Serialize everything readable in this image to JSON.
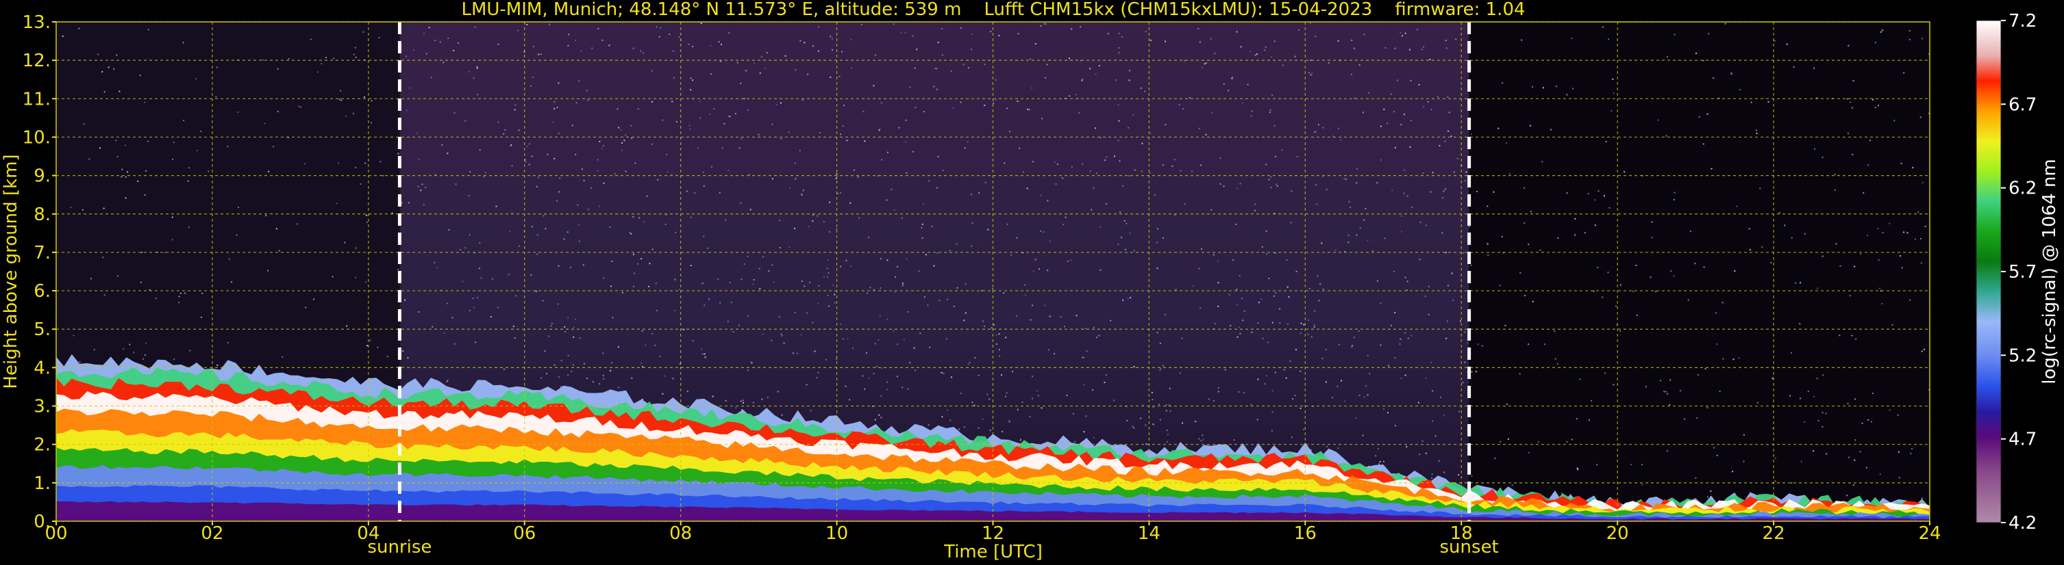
{
  "chart_data": {
    "type": "heatmap",
    "title": "LMU-MIM, Munich; 48.148° N 11.573° E, altitude: 539 m    Lufft CHM15kx (CHM15kxLMU): 15-04-2023    firmware: 1.04",
    "xlabel": "Time [UTC]",
    "ylabel": "Height above ground [km]",
    "xlim": [
      0,
      24
    ],
    "ylim": [
      0,
      13
    ],
    "x_ticks": [
      "00",
      "02",
      "04",
      "06",
      "08",
      "10",
      "12",
      "14",
      "16",
      "18",
      "20",
      "22",
      "24"
    ],
    "y_ticks": [
      "0.",
      "1.",
      "2.",
      "3.",
      "4.",
      "5.",
      "6.",
      "7.",
      "8.",
      "9.",
      "10.",
      "11.",
      "12.",
      "13."
    ],
    "grid": true,
    "markers": [
      {
        "label": "sunrise",
        "x": 4.4
      },
      {
        "label": "sunset",
        "x": 18.1
      }
    ],
    "colorbar": {
      "label": "log(rc-signal) @ 1064 nm",
      "min": 4.2,
      "max": 7.2,
      "ticks": [
        "7.2",
        "6.7",
        "6.2",
        "5.7",
        "5.2",
        "4.7",
        "4.2"
      ]
    },
    "layers": [
      {
        "name": "boundary-layer-top",
        "x": [
          0,
          2,
          4,
          6,
          8,
          10,
          12,
          14,
          16,
          18,
          20,
          22,
          24
        ],
        "y": [
          4.2,
          4.1,
          3.6,
          3.5,
          3.1,
          2.6,
          2.2,
          1.9,
          1.9,
          0.9,
          0.5,
          0.6,
          0.5
        ]
      }
    ]
  }
}
